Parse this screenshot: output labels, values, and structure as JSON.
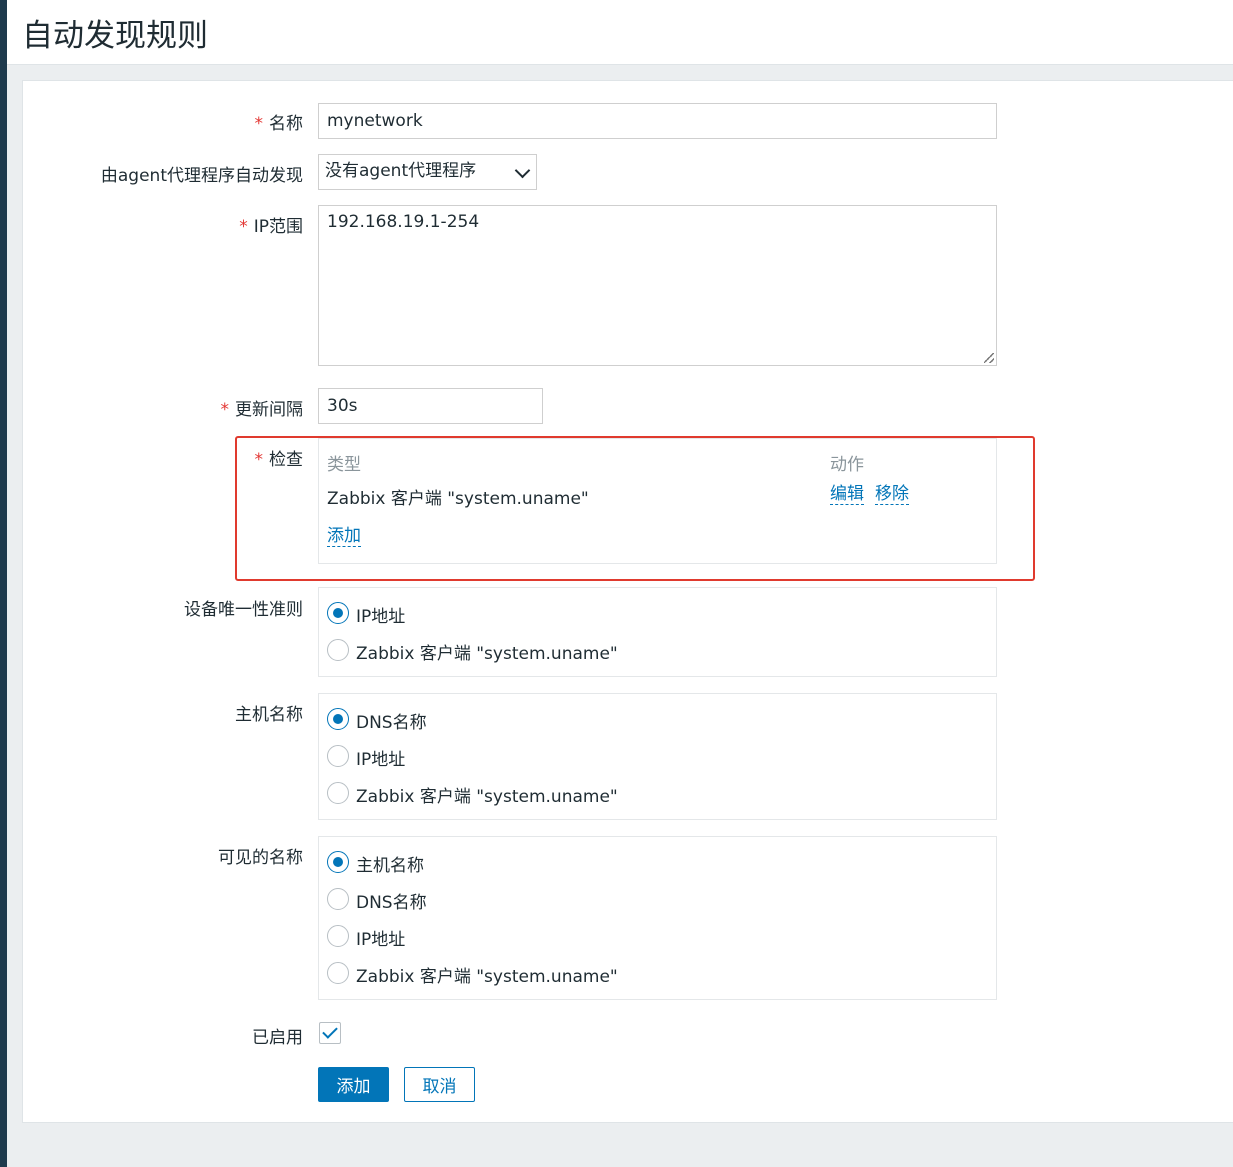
{
  "page": {
    "title": "自动发现规则"
  },
  "form": {
    "name": {
      "label": "名称",
      "required_mark": "*",
      "value": "mynetwork"
    },
    "proxy": {
      "label": "由agent代理程序自动发现",
      "selected": "没有agent代理程序"
    },
    "ip_range": {
      "label": "IP范围",
      "required_mark": "*",
      "value": "192.168.19.1-254"
    },
    "update_interval": {
      "label": "更新间隔",
      "required_mark": "*",
      "value": "30s"
    },
    "checks": {
      "label": "检查",
      "required_mark": "*",
      "columns": {
        "type": "类型",
        "action": "动作"
      },
      "rows": [
        {
          "type": "Zabbix 客户端 \"system.uname\"",
          "edit": "编辑",
          "remove": "移除"
        }
      ],
      "add_link": "添加"
    },
    "uniqueness": {
      "label": "设备唯一性准则",
      "options": [
        {
          "label": "IP地址",
          "checked": true
        },
        {
          "label": "Zabbix 客户端 \"system.uname\"",
          "checked": false
        }
      ]
    },
    "host_name": {
      "label": "主机名称",
      "options": [
        {
          "label": "DNS名称",
          "checked": true
        },
        {
          "label": "IP地址",
          "checked": false
        },
        {
          "label": "Zabbix 客户端 \"system.uname\"",
          "checked": false
        }
      ]
    },
    "visible_name": {
      "label": "可见的名称",
      "options": [
        {
          "label": "主机名称",
          "checked": true
        },
        {
          "label": "DNS名称",
          "checked": false
        },
        {
          "label": "IP地址",
          "checked": false
        },
        {
          "label": "Zabbix 客户端 \"system.uname\"",
          "checked": false
        }
      ]
    },
    "enabled": {
      "label": "已启用",
      "checked": true
    },
    "buttons": {
      "add": "添加",
      "cancel": "取消"
    }
  },
  "colors": {
    "accent": "#0275b8",
    "required": "#e33734",
    "highlight": "#e03a2e"
  }
}
